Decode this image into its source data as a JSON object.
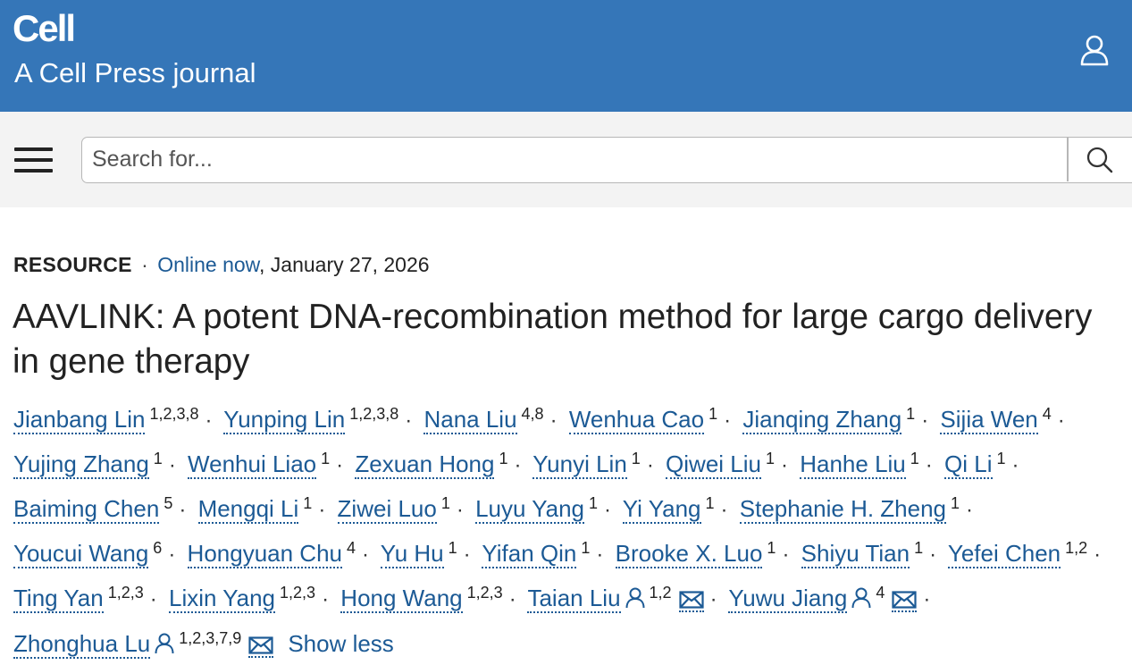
{
  "header": {
    "brand": "Cell",
    "tagline": "A Cell Press journal"
  },
  "search": {
    "placeholder": "Search for..."
  },
  "article": {
    "type": "RESOURCE",
    "separator": "·",
    "online_label": "Online now",
    "date": ", January 27, 2026",
    "title": "AAVLINK: A potent DNA-recombination method for large cargo delivery in gene therapy",
    "authors": [
      {
        "name": "Jianbang Lin",
        "sup": "1,2,3,8"
      },
      {
        "name": "Yunping Lin",
        "sup": "1,2,3,8"
      },
      {
        "name": "Nana Liu",
        "sup": "4,8"
      },
      {
        "name": "Wenhua Cao",
        "sup": "1"
      },
      {
        "name": "Jianqing Zhang",
        "sup": "1"
      },
      {
        "name": "Sijia Wen",
        "sup": "4"
      },
      {
        "name": "Yujing Zhang",
        "sup": "1"
      },
      {
        "name": "Wenhui Liao",
        "sup": "1"
      },
      {
        "name": "Zexuan Hong",
        "sup": "1"
      },
      {
        "name": "Yunyi Lin",
        "sup": "1"
      },
      {
        "name": "Qiwei Liu",
        "sup": "1"
      },
      {
        "name": "Hanhe Liu",
        "sup": "1"
      },
      {
        "name": "Qi Li",
        "sup": "1"
      },
      {
        "name": "Baiming Chen",
        "sup": "5"
      },
      {
        "name": "Mengqi Li",
        "sup": "1"
      },
      {
        "name": "Ziwei Luo",
        "sup": "1"
      },
      {
        "name": "Luyu Yang",
        "sup": "1"
      },
      {
        "name": "Yi Yang",
        "sup": "1"
      },
      {
        "name": "Stephanie H. Zheng",
        "sup": "1"
      },
      {
        "name": "Youcui Wang",
        "sup": "6"
      },
      {
        "name": "Hongyuan Chu",
        "sup": "4"
      },
      {
        "name": "Yu Hu",
        "sup": "1"
      },
      {
        "name": "Yifan Qin",
        "sup": "1"
      },
      {
        "name": "Brooke X. Luo",
        "sup": "1"
      },
      {
        "name": "Shiyu Tian",
        "sup": "1"
      },
      {
        "name": "Yefei Chen",
        "sup": "1,2"
      },
      {
        "name": "Ting Yan",
        "sup": "1,2,3"
      },
      {
        "name": "Lixin Yang",
        "sup": "1,2,3"
      },
      {
        "name": "Hong Wang",
        "sup": "1,2,3"
      },
      {
        "name": "Taian Liu",
        "sup": "1,2",
        "corresponding": true
      },
      {
        "name": "Yuwu Jiang",
        "sup": "4",
        "corresponding": true
      },
      {
        "name": "Zhonghua Lu",
        "sup": "1,2,3,7,9",
        "corresponding": true
      }
    ],
    "show_less": "Show less"
  },
  "colors": {
    "header_bg": "#3576b8",
    "link": "#1c5a95",
    "search_bg": "#f3f3f3"
  },
  "icons": {
    "account": "user-account-icon",
    "menu": "hamburger-menu-icon",
    "search": "search-icon",
    "author": "person-icon",
    "mail": "envelope-icon"
  }
}
